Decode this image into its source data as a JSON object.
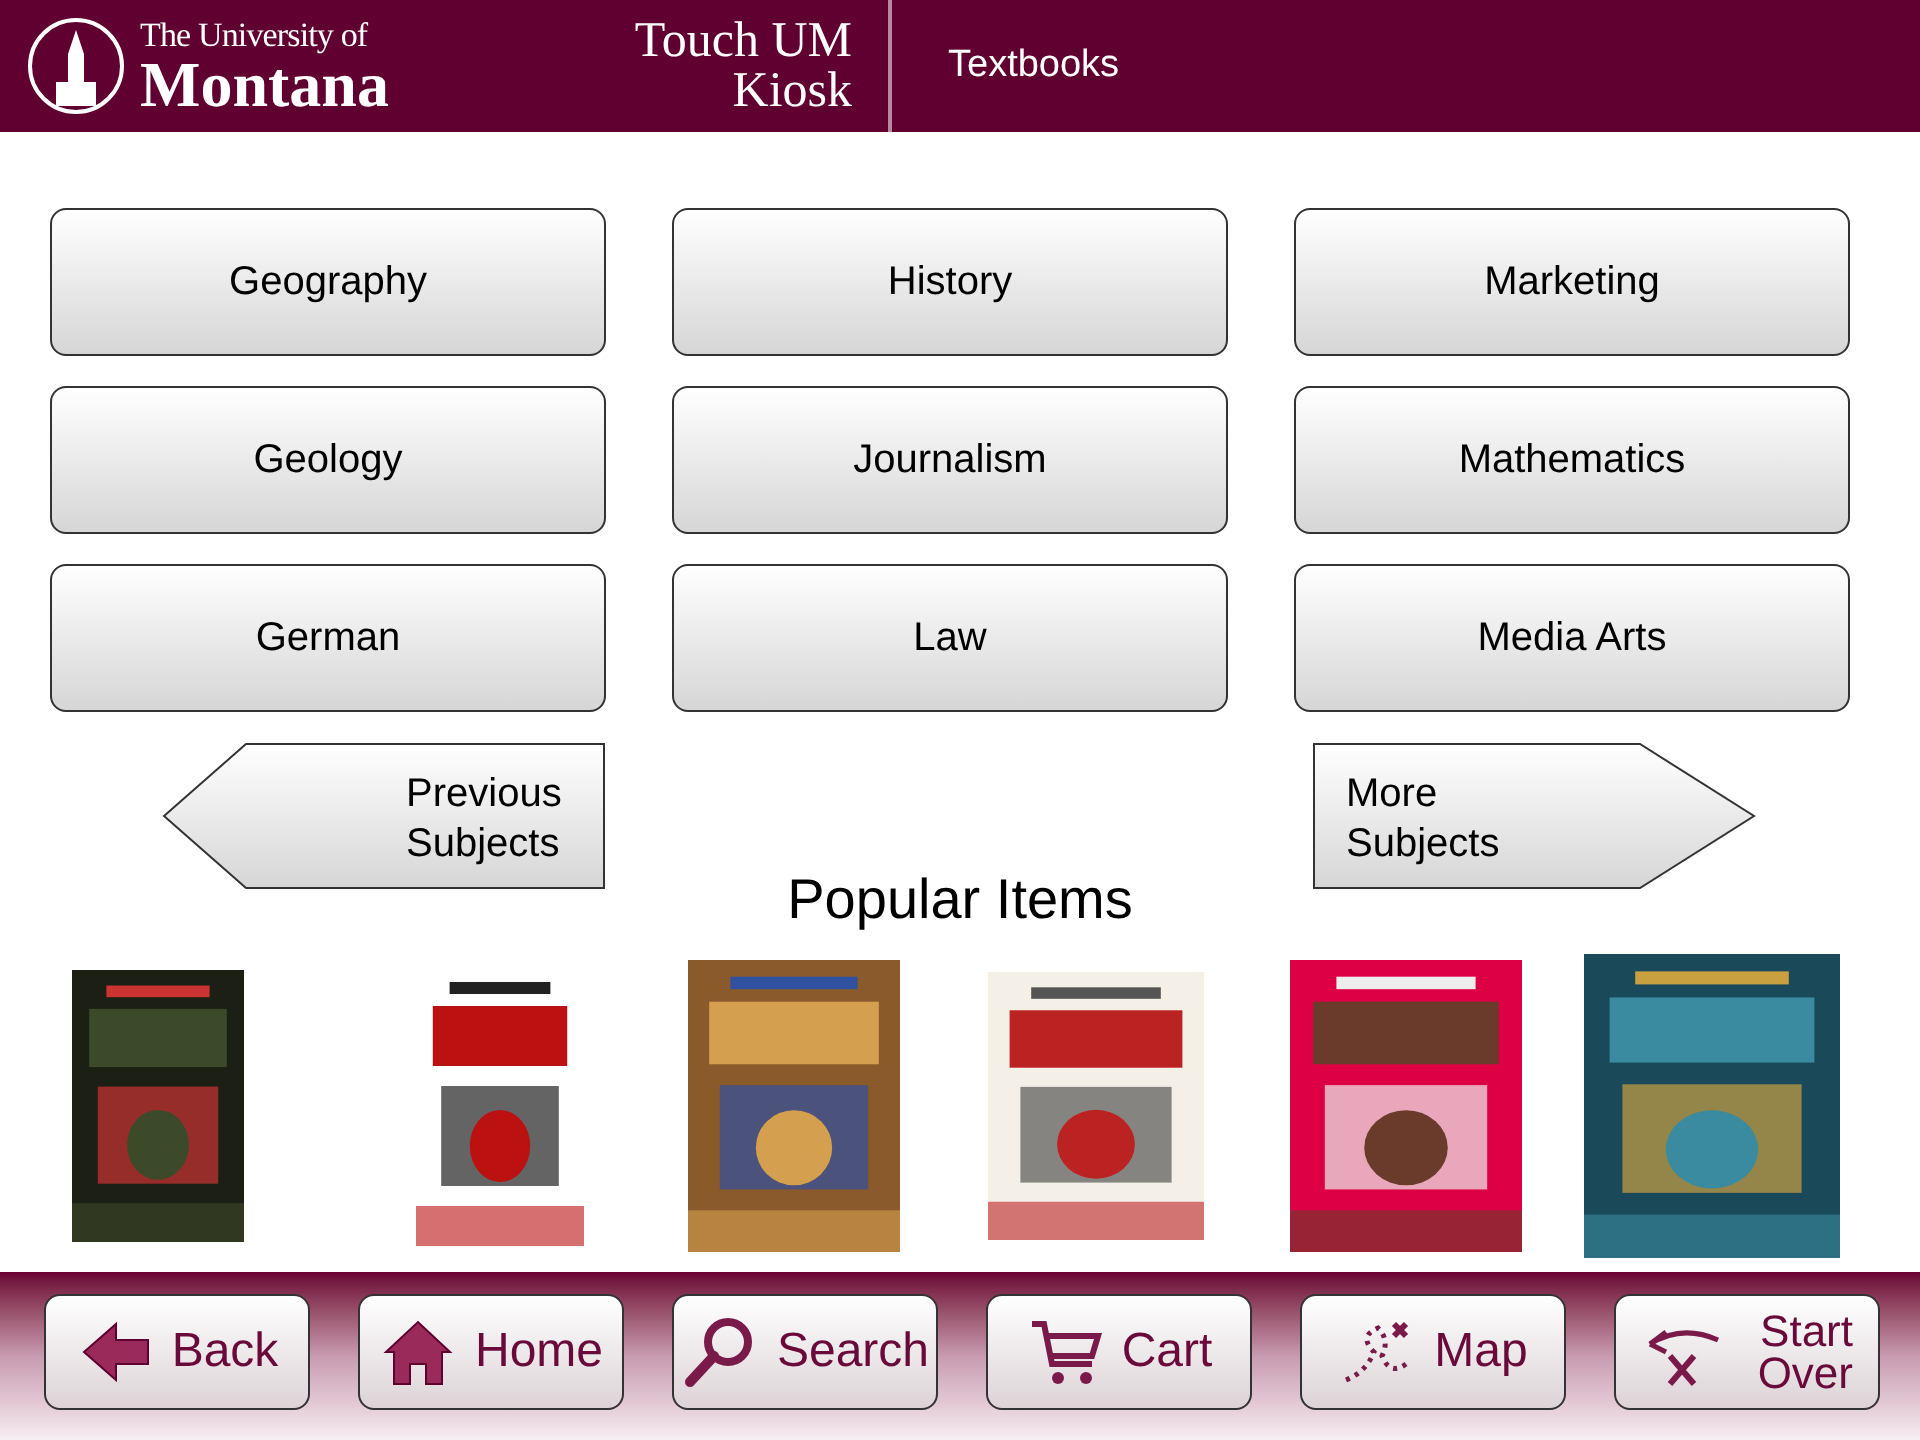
{
  "header": {
    "university_line1": "The University of",
    "university_line2": "Montana",
    "kiosk_line1": "Touch UM",
    "kiosk_line2": "Kiosk",
    "section_title": "Textbooks"
  },
  "subjects": [
    "Geography",
    "History",
    "Marketing",
    "Geology",
    "Journalism",
    "Mathematics",
    "German",
    "Law",
    "Media Arts"
  ],
  "navigation": [
    {
      "kind": "previous",
      "label": "Previous Subjects"
    },
    {
      "kind": "next",
      "label": "More Subjects"
    }
  ],
  "popular": {
    "title": "Popular Items"
  },
  "toolbar": [
    {
      "kind": "back",
      "label": "Back"
    },
    {
      "kind": "home",
      "label": "Home"
    },
    {
      "kind": "search",
      "label": "Search"
    },
    {
      "kind": "cart",
      "label": "Cart"
    },
    {
      "kind": "map",
      "label": "Map"
    },
    {
      "kind": "restart",
      "label": "Start Over"
    }
  ]
}
